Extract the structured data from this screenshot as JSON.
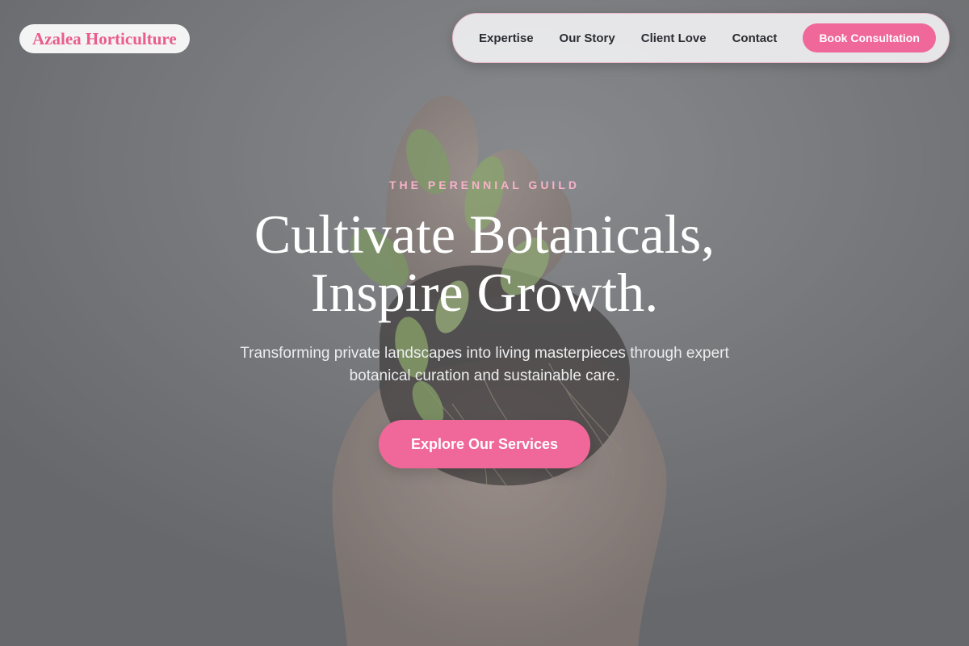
{
  "brand": {
    "name": "Azalea Horticulture",
    "accent_color": "#f0679a"
  },
  "nav": {
    "links": [
      {
        "label": "Expertise"
      },
      {
        "label": "Our Story"
      },
      {
        "label": "Client Love"
      },
      {
        "label": "Contact"
      }
    ],
    "cta_label": "Book Consultation"
  },
  "hero": {
    "eyebrow": "THE PERENNIAL GUILD",
    "headline_line1": "Cultivate Botanicals,",
    "headline_line2": "Inspire Growth.",
    "subtext": "Transforming private landscapes into living masterpieces through expert botanical curation and sustainable care.",
    "cta_label": "Explore Our Services",
    "background_image": "hand-holding-seedling-photo"
  }
}
